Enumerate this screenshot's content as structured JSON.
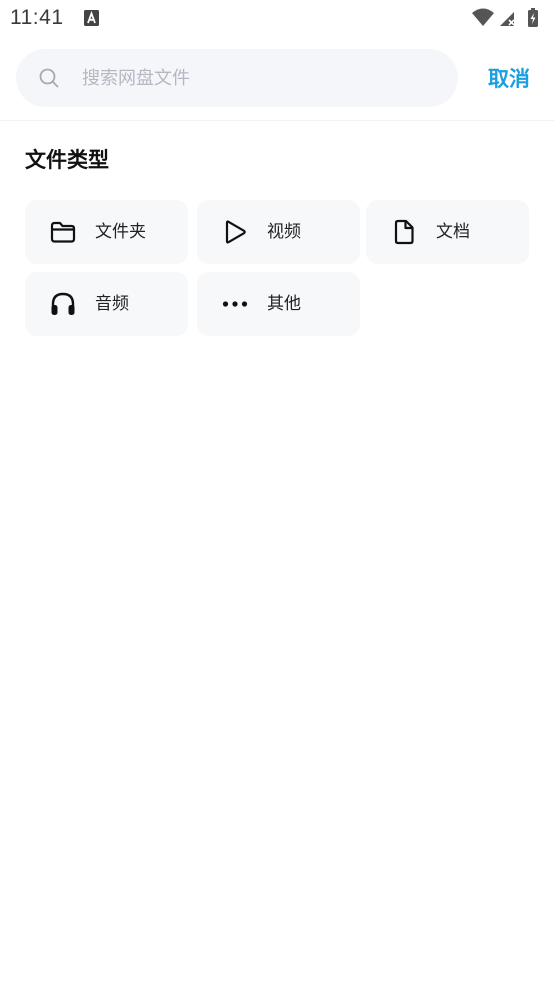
{
  "status_bar": {
    "time": "11:41"
  },
  "search": {
    "placeholder": "搜索网盘文件",
    "value": ""
  },
  "cancel_label": "取消",
  "section_title": "文件类型",
  "file_types": [
    {
      "label": "文件夹",
      "icon": "folder-icon"
    },
    {
      "label": "视频",
      "icon": "play-icon"
    },
    {
      "label": "文档",
      "icon": "document-icon"
    },
    {
      "label": "音频",
      "icon": "headphones-icon"
    },
    {
      "label": "其他",
      "icon": "more-icon"
    }
  ],
  "colors": {
    "accent": "#1c9fe0",
    "tile_bg": "#f7f8fa",
    "search_bg": "#f5f6fa"
  }
}
